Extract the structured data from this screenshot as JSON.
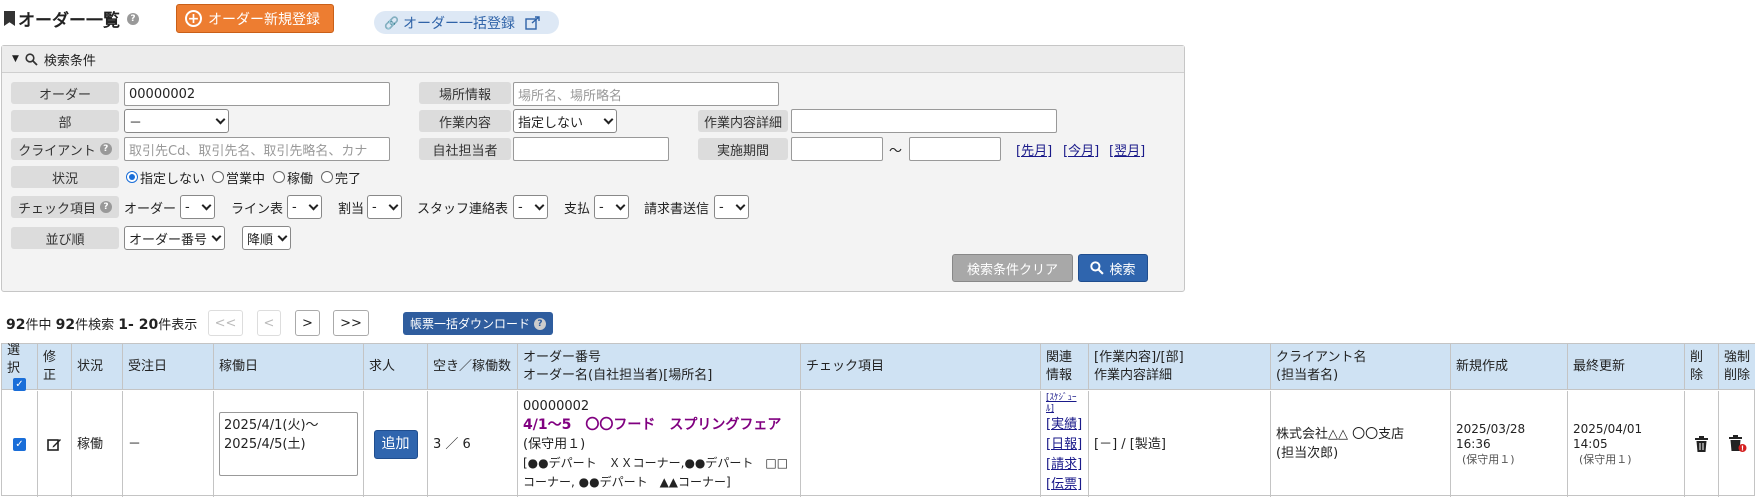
{
  "header": {
    "title": "オーダー一覧",
    "new_button": "オーダー新規登録",
    "bulk_button": "オーダー一括登録"
  },
  "search": {
    "panel_title": "検索条件",
    "order": {
      "label": "オーダー",
      "value": "00000002"
    },
    "place": {
      "label": "場所情報",
      "placeholder": "場所名、場所略名"
    },
    "dept": {
      "label": "部",
      "value": "－"
    },
    "work": {
      "label": "作業内容",
      "value": "指定しない"
    },
    "work_detail": {
      "label": "作業内容詳細",
      "value": ""
    },
    "client": {
      "label": "クライアント",
      "placeholder": "取引先Cd、取引先名、取引先略名、カナ"
    },
    "staff": {
      "label": "自社担当者",
      "value": ""
    },
    "period": {
      "label": "実施期間",
      "tilde": "～",
      "prev": "[先月]",
      "this": "[今月]",
      "next": "[翌月]"
    },
    "status": {
      "label": "状況",
      "options": [
        "指定しない",
        "営業中",
        "稼働",
        "完了"
      ]
    },
    "check": {
      "label": "チェック項目",
      "items": [
        {
          "name": "オーダー",
          "value": "-"
        },
        {
          "name": "ライン表",
          "value": "-"
        },
        {
          "name": "割当",
          "value": "-"
        },
        {
          "name": "スタッフ連絡表",
          "value": "-"
        },
        {
          "name": "支払",
          "value": "-"
        },
        {
          "name": "請求書送信",
          "value": "-"
        }
      ]
    },
    "sort": {
      "label": "並び順",
      "field": "オーダー番号",
      "dir": "降順"
    },
    "clear_button": "検索条件クリア",
    "search_button": "検索"
  },
  "paging": {
    "total": "92",
    "total_suffix": "件中",
    "hits": "92",
    "hits_suffix": "件検索",
    "range": "1- 20",
    "range_suffix": "件表示",
    "first": "<<",
    "prev": "<",
    "next": ">",
    "last": ">>",
    "download_button": "帳票一括ダウンロード"
  },
  "table": {
    "headers": {
      "select": "選択",
      "edit": "修正",
      "status": "状況",
      "received": "受注日",
      "workdays": "稼働日",
      "recruit": "求人",
      "vacancy": "空き／稼働数",
      "order_line1": "オーダー番号",
      "order_line2": "オーダー名(自社担当者)[場所名]",
      "check": "チェック項目",
      "related_line1": "関連",
      "related_line2": "情報",
      "work_line1": "[作業内容]/[部]",
      "work_line2": "作業内容詳細",
      "client_line1": "クライアント名",
      "client_line2": "(担当者名)",
      "created": "新規作成",
      "updated": "最終更新",
      "delete": "削除",
      "force_line1": "強制",
      "force_line2": "削除"
    },
    "rows": [
      {
        "status": "稼働",
        "received": "－",
        "workdays": "2025/4/1(火)～\n2025/4/5(土)",
        "add_button": "追加",
        "vacancy": "3 ／ 6",
        "order_no": "00000002",
        "order_name": "4/1～5　〇〇フード　スプリングフェア",
        "staff": "(保守用１)",
        "place": "[●●デパート　ＸＸコーナー,●●デパート　□□コーナー, ●●デパート　▲▲コーナー]",
        "related": [
          "[ｽｹｼﾞｭｰﾙ]",
          "[実績]",
          "[日報]",
          "[請求]",
          "[伝票]"
        ],
        "work": "[－] / [製造]",
        "client_name": "株式会社△△ 〇〇支店",
        "client_person": "(担当次郎)",
        "created_at": "2025/03/28 16:36",
        "created_by": "(保守用１)",
        "updated_at": "2025/04/01 14:05",
        "updated_by": "(保守用１)"
      }
    ]
  }
}
